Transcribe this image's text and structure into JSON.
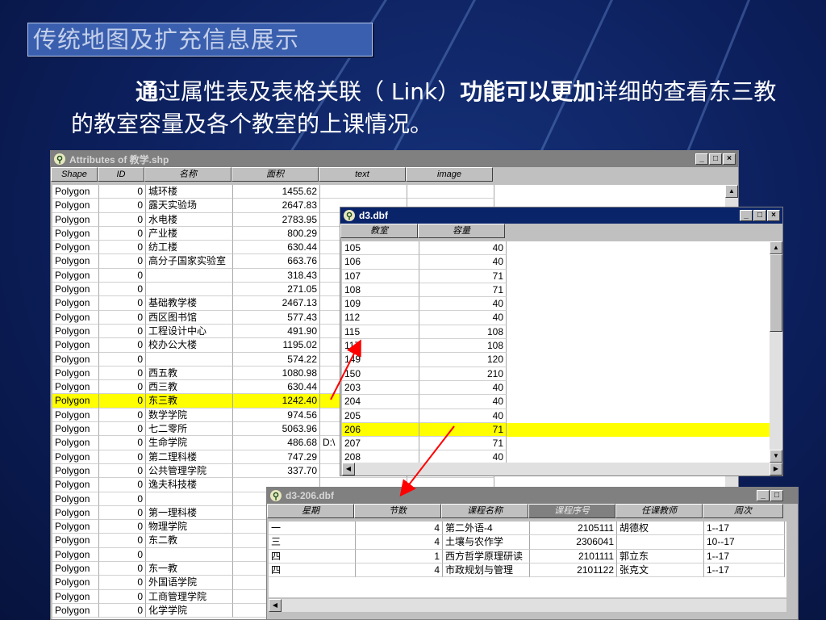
{
  "slide": {
    "title": "传统地图及扩充信息展示",
    "body_bold1": "通",
    "body_text1": "过属性表及表格关联（",
    "body_link": " Link",
    "body_text2": "）",
    "body_bold2": "功能可以更加",
    "body_text3": "详细的查看东三教的教室容量及各个教室的上课情况。"
  },
  "attributes_window": {
    "title": "Attributes of 教学.shp",
    "columns": [
      "Shape",
      "ID",
      "名称",
      "面积",
      "text",
      "image"
    ],
    "rows": [
      [
        "Polygon",
        "0",
        "城环楼",
        "1455.62",
        "",
        ""
      ],
      [
        "Polygon",
        "0",
        "露天实验场",
        "2647.83",
        "",
        ""
      ],
      [
        "Polygon",
        "0",
        "水电楼",
        "2783.95",
        "",
        ""
      ],
      [
        "Polygon",
        "0",
        "产业楼",
        "800.29",
        "",
        ""
      ],
      [
        "Polygon",
        "0",
        "纺工楼",
        "630.44",
        "",
        ""
      ],
      [
        "Polygon",
        "0",
        "高分子国家实验室",
        "663.76",
        "",
        ""
      ],
      [
        "Polygon",
        "0",
        "",
        "318.43",
        "",
        ""
      ],
      [
        "Polygon",
        "0",
        "",
        "271.05",
        "",
        ""
      ],
      [
        "Polygon",
        "0",
        "基础教学楼",
        "2467.13",
        "",
        ""
      ],
      [
        "Polygon",
        "0",
        "西区图书馆",
        "577.43",
        "",
        ""
      ],
      [
        "Polygon",
        "0",
        "工程设计中心",
        "491.90",
        "",
        ""
      ],
      [
        "Polygon",
        "0",
        "校办公大楼",
        "1195.02",
        "",
        ""
      ],
      [
        "Polygon",
        "0",
        "",
        "574.22",
        "",
        ""
      ],
      [
        "Polygon",
        "0",
        "西五教",
        "1080.98",
        "",
        ""
      ],
      [
        "Polygon",
        "0",
        "西三教",
        "630.44",
        "",
        ""
      ],
      [
        "Polygon",
        "0",
        "东三教",
        "1242.40",
        "",
        ""
      ],
      [
        "Polygon",
        "0",
        "数学学院",
        "974.56",
        "",
        ""
      ],
      [
        "Polygon",
        "0",
        "七二零所",
        "5063.96",
        "",
        ""
      ],
      [
        "Polygon",
        "0",
        "生命学院",
        "486.68",
        "D:\\",
        ""
      ],
      [
        "Polygon",
        "0",
        "第二理科楼",
        "747.29",
        "",
        ""
      ],
      [
        "Polygon",
        "0",
        "公共管理学院",
        "337.70",
        "",
        ""
      ],
      [
        "Polygon",
        "0",
        "逸夫科技楼",
        "",
        "",
        ""
      ],
      [
        "Polygon",
        "0",
        "",
        "",
        "",
        ""
      ],
      [
        "Polygon",
        "0",
        "第一理科楼",
        "",
        "",
        ""
      ],
      [
        "Polygon",
        "0",
        "物理学院",
        "",
        "",
        ""
      ],
      [
        "Polygon",
        "0",
        "东二教",
        "",
        "",
        ""
      ],
      [
        "Polygon",
        "0",
        "",
        "",
        "",
        ""
      ],
      [
        "Polygon",
        "0",
        "东一教",
        "",
        "",
        ""
      ],
      [
        "Polygon",
        "0",
        "外国语学院",
        "",
        "",
        ""
      ],
      [
        "Polygon",
        "0",
        "工商管理学院",
        "",
        "",
        ""
      ],
      [
        "Polygon",
        "0",
        "化学学院",
        "",
        "",
        ""
      ]
    ],
    "highlight_row": 15
  },
  "d3_window": {
    "title": "d3.dbf",
    "columns": [
      "教室",
      "容量"
    ],
    "rows": [
      [
        "105",
        "40"
      ],
      [
        "106",
        "40"
      ],
      [
        "107",
        "71"
      ],
      [
        "108",
        "71"
      ],
      [
        "109",
        "40"
      ],
      [
        "112",
        "40"
      ],
      [
        "115",
        "108"
      ],
      [
        "117",
        "108"
      ],
      [
        "149",
        "120"
      ],
      [
        "150",
        "210"
      ],
      [
        "203",
        "40"
      ],
      [
        "204",
        "40"
      ],
      [
        "205",
        "40"
      ],
      [
        "206",
        "71"
      ],
      [
        "207",
        "71"
      ],
      [
        "208",
        "40"
      ]
    ],
    "highlight_row": 13
  },
  "d3_206_window": {
    "title": "d3-206.dbf",
    "columns": [
      "星期",
      "节数",
      "课程名称",
      "课程序号",
      "任课教师",
      "周次"
    ],
    "selected_column": 3,
    "rows": [
      [
        "一",
        "4",
        "第二外语-4",
        "2105111",
        "胡德权",
        "1--17"
      ],
      [
        "三",
        "4",
        "土壤与农作学",
        "2306041",
        "",
        "10--17"
      ],
      [
        "四",
        "1",
        "西方哲学原理研读",
        "2101111",
        "郭立东",
        "1--17"
      ],
      [
        "四",
        "4",
        "市政规划与管理",
        "2101122",
        "张克文",
        "1--17"
      ]
    ]
  },
  "colors": {
    "background": "#0c1f5c",
    "active_title": "#0a246a",
    "highlight": "#ffff00",
    "arrow": "#ff0000"
  }
}
